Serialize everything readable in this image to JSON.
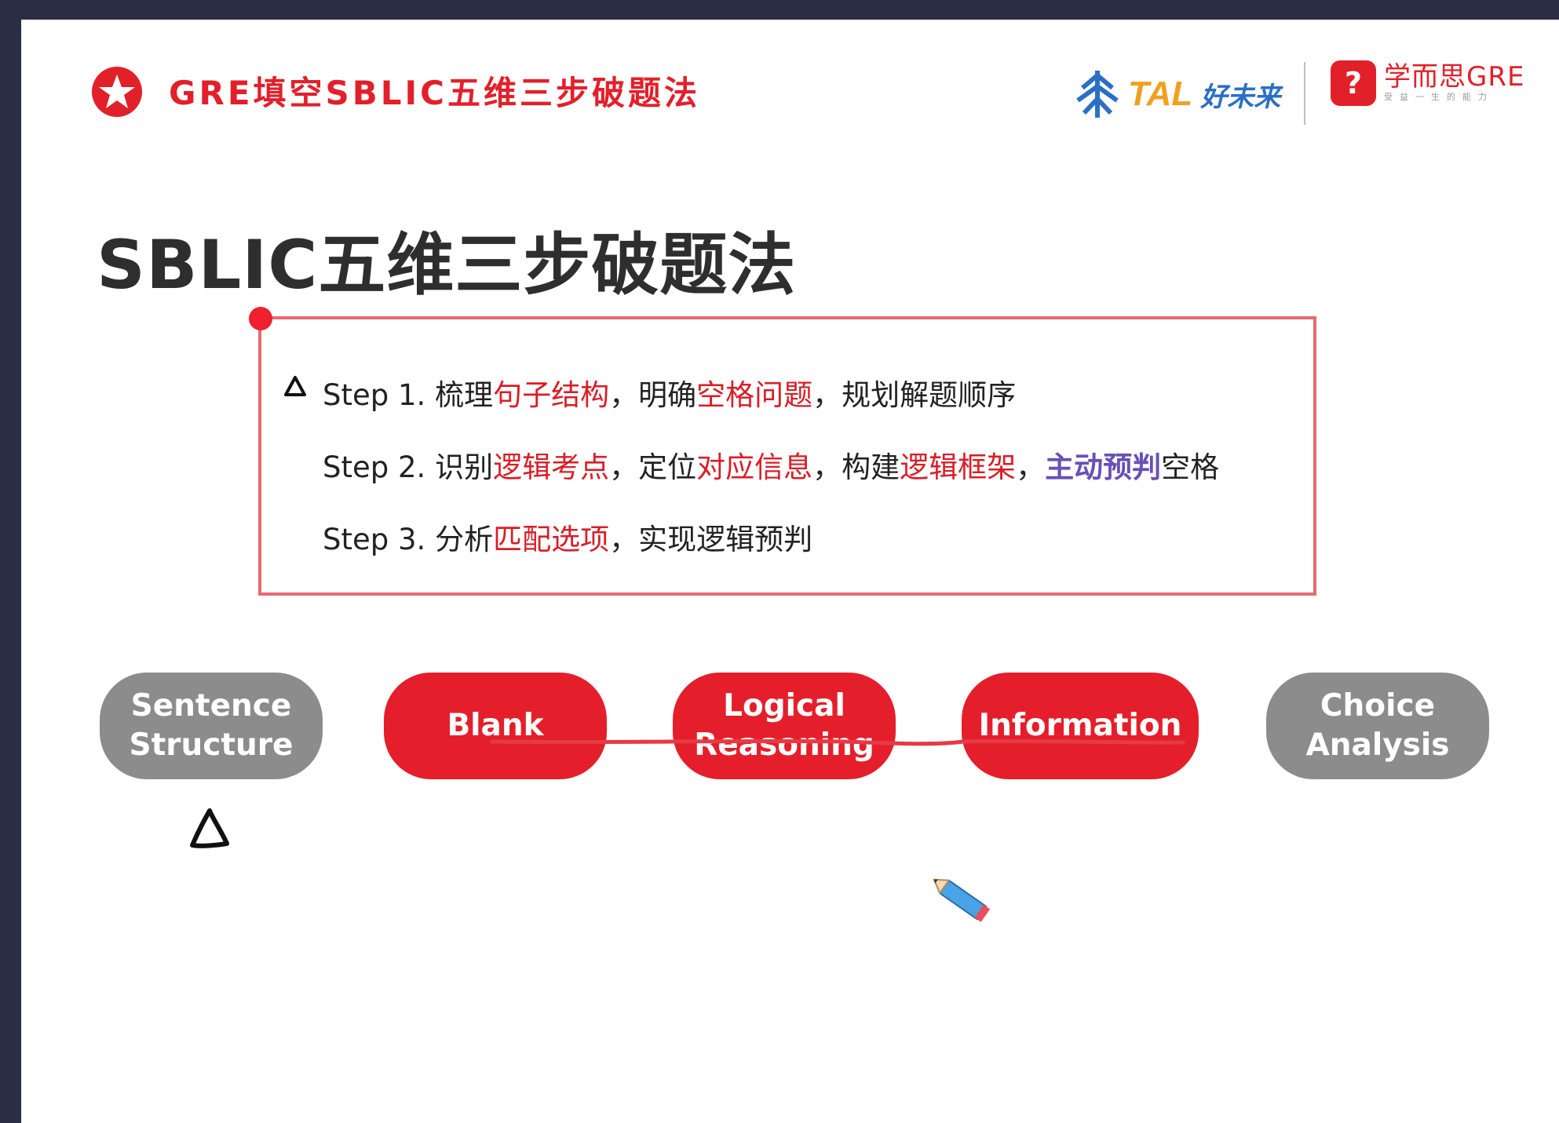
{
  "header": {
    "title": "GRE填空SBLIC五维三步破题法",
    "tal_text": "TAL",
    "tal_cn": "好未来",
    "xes_badge": "?",
    "xes_main": "学而思GRE",
    "xes_sub": "受益一生的能力"
  },
  "main_title": "SBLIC五维三步破题法",
  "steps": [
    {
      "label": "Step 1. ",
      "parts": [
        {
          "t": "梳理",
          "c": ""
        },
        {
          "t": "句子结构",
          "c": "red"
        },
        {
          "t": "，明确",
          "c": ""
        },
        {
          "t": "空格问题",
          "c": "red"
        },
        {
          "t": "，规划解题顺序",
          "c": ""
        }
      ]
    },
    {
      "label": "Step 2. ",
      "parts": [
        {
          "t": "识别",
          "c": ""
        },
        {
          "t": "逻辑考点",
          "c": "red"
        },
        {
          "t": "，定位",
          "c": ""
        },
        {
          "t": "对应信息",
          "c": "red"
        },
        {
          "t": "，构建",
          "c": ""
        },
        {
          "t": "逻辑框架",
          "c": "red"
        },
        {
          "t": "，",
          "c": ""
        },
        {
          "t": "主动预判",
          "c": "purple"
        },
        {
          "t": "空格",
          "c": ""
        }
      ]
    },
    {
      "label": "Step 3. ",
      "parts": [
        {
          "t": "分析",
          "c": ""
        },
        {
          "t": "匹配选项",
          "c": "red"
        },
        {
          "t": "，实现逻辑预判",
          "c": ""
        }
      ]
    }
  ],
  "pills": {
    "sentence_line1": "Sentence",
    "sentence_line2": "Structure",
    "blank": "Blank",
    "logical_line1": "Logical",
    "logical_line2": "Reasoning",
    "information": "Information",
    "choice_line1": "Choice",
    "choice_line2": "Analysis"
  },
  "colors": {
    "accent_red": "#e2202a",
    "pill_gray": "#8c8c8c",
    "highlight_purple": "#6a4fb6",
    "background": "#2b2d46"
  }
}
